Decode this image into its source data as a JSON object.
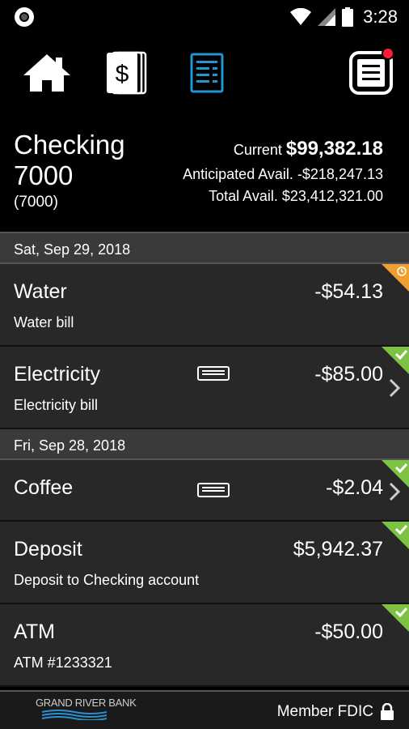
{
  "status_bar": {
    "time": "3:28"
  },
  "nav": {
    "items": [
      {
        "name": "home",
        "icon": "home-icon"
      },
      {
        "name": "transfers",
        "icon": "dollar-cards-icon"
      },
      {
        "name": "transactions",
        "icon": "ledger-icon",
        "active": true
      },
      {
        "name": "menu",
        "icon": "menu-icon",
        "notification": true
      }
    ]
  },
  "account": {
    "name": "Checking 7000",
    "number": "(7000)",
    "current_label": "Current",
    "current_value": "$99,382.18",
    "anticipated": "Anticipated Avail. -$218,247.13",
    "total": "Total Avail. $23,412,321.00"
  },
  "groups": [
    {
      "date": "Sat, Sep 29, 2018",
      "transactions": [
        {
          "title": "Water",
          "description": "Water bill",
          "amount": "-$54.13",
          "status": "pending"
        },
        {
          "title": "Electricity",
          "description": "Electricity bill",
          "amount": "-$85.00",
          "status": "cleared",
          "card": true,
          "chevron": true
        }
      ]
    },
    {
      "date": "Fri, Sep 28, 2018",
      "transactions": [
        {
          "title": "Coffee",
          "description": "",
          "amount": "-$2.04",
          "status": "cleared",
          "card": true,
          "chevron": true
        },
        {
          "title": "Deposit",
          "description": "Deposit to Checking account",
          "amount": "$5,942.37",
          "status": "cleared"
        },
        {
          "title": "ATM",
          "description": "ATM #1233321",
          "amount": "-$50.00",
          "status": "cleared"
        }
      ]
    }
  ],
  "footer": {
    "bank_name": "GRAND RIVER BANK",
    "fdic": "Member FDIC"
  },
  "colors": {
    "accent": "#2196d3",
    "pending": "#f0a030",
    "cleared": "#7dc242",
    "notification": "#ff1a3c"
  }
}
